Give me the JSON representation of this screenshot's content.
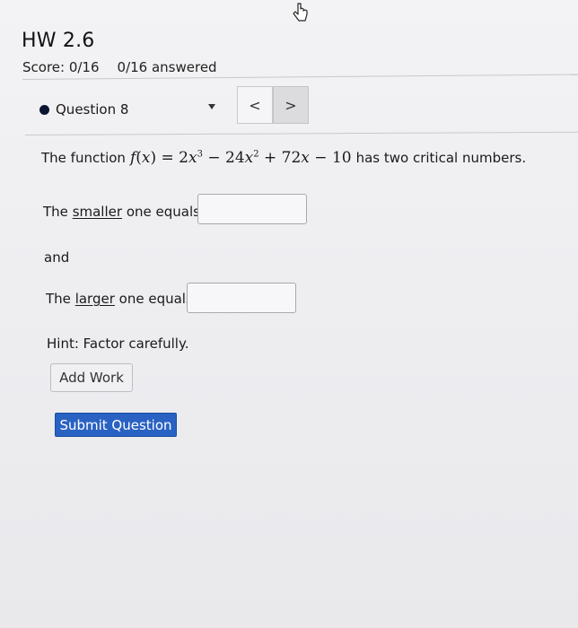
{
  "assignment": {
    "title": "HW 2.6",
    "score": "Score: 0/16",
    "answered": "0/16 answered"
  },
  "question_nav": {
    "selected": "Question 8",
    "prev_label": "<",
    "next_label": ">"
  },
  "problem": {
    "intro": "The function",
    "outro": "has two critical numbers.",
    "smaller_prefix": "The",
    "smaller_word": "smaller",
    "smaller_suffix": "one equals",
    "smaller_value": "",
    "conjunction": "and",
    "larger_prefix": "The",
    "larger_word": "larger",
    "larger_suffix": "one equals",
    "larger_value": "",
    "hint": "Hint: Factor carefully."
  },
  "actions": {
    "add_work": "Add Work",
    "submit": "Submit Question"
  }
}
